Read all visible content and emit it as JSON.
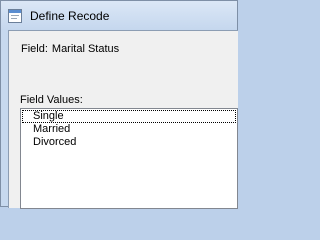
{
  "window": {
    "title": "Define Recode",
    "icon": "window-app-icon"
  },
  "field": {
    "label": "Field:",
    "value": "Marital Status"
  },
  "field_values": {
    "label": "Field Values:",
    "items": [
      "Single",
      "Married",
      "Divorced"
    ],
    "focused_index": 0
  },
  "colors": {
    "titlebar": "#c5d7ee",
    "client_background": "#f0f0f0",
    "listbox_background": "#ffffff"
  }
}
